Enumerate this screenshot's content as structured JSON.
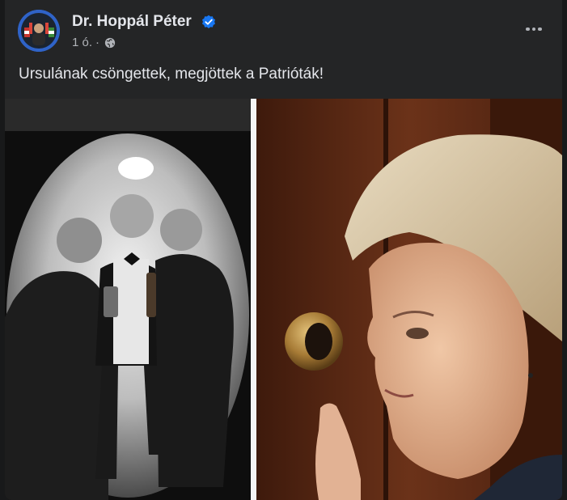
{
  "post": {
    "author": "Dr. Hoppál Péter",
    "timestamp": "1 ó.",
    "separator": "·",
    "audience_icon": "globe-icon",
    "verified_icon": "verified-badge-icon",
    "menu_icon": "more-options-icon",
    "caption": "Ursulának csöngettek, megjöttek a Patrióták!"
  },
  "colors": {
    "background": "#18191a",
    "card": "#242526",
    "primary_text": "#e4e6eb",
    "secondary_text": "#b0b3b8",
    "verified": "#1877f2"
  }
}
